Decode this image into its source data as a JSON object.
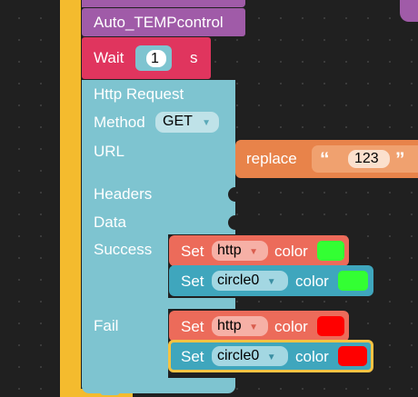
{
  "blocks": {
    "top_label": "Auto_TEMPcontrol",
    "wait": {
      "label": "Wait",
      "value": "1",
      "unit": "s"
    },
    "http": {
      "title": "Http Request",
      "method_label": "Method",
      "method_value": "GET",
      "url_label": "URL",
      "headers_label": "Headers",
      "data_label": "Data",
      "success_label": "Success",
      "fail_label": "Fail"
    },
    "replace": {
      "label": "replace",
      "open_quote": "“",
      "value": "123",
      "close_quote": "”"
    },
    "success_actions": [
      {
        "set": "Set",
        "target": "http",
        "color_label": "color",
        "color": "#33ff33"
      },
      {
        "set": "Set",
        "target": "circle0",
        "color_label": "color",
        "color": "#33ff33"
      }
    ],
    "fail_actions": [
      {
        "set": "Set",
        "target": "http",
        "color_label": "color",
        "color": "#ff0000"
      },
      {
        "set": "Set",
        "target": "circle0",
        "color_label": "color",
        "color": "#ff0000"
      }
    ]
  },
  "colors": {
    "workspace": "#202020",
    "outer_stack": "#f4bb2e",
    "procedure": "#a05ba8",
    "wait_block": "#e0355e",
    "http_block": "#7ec4d0",
    "replace_block": "#e8834a",
    "set_http_block": "#ec6b5a",
    "set_circle_block": "#3fa6bd",
    "selected_outline": "#f5c342"
  }
}
